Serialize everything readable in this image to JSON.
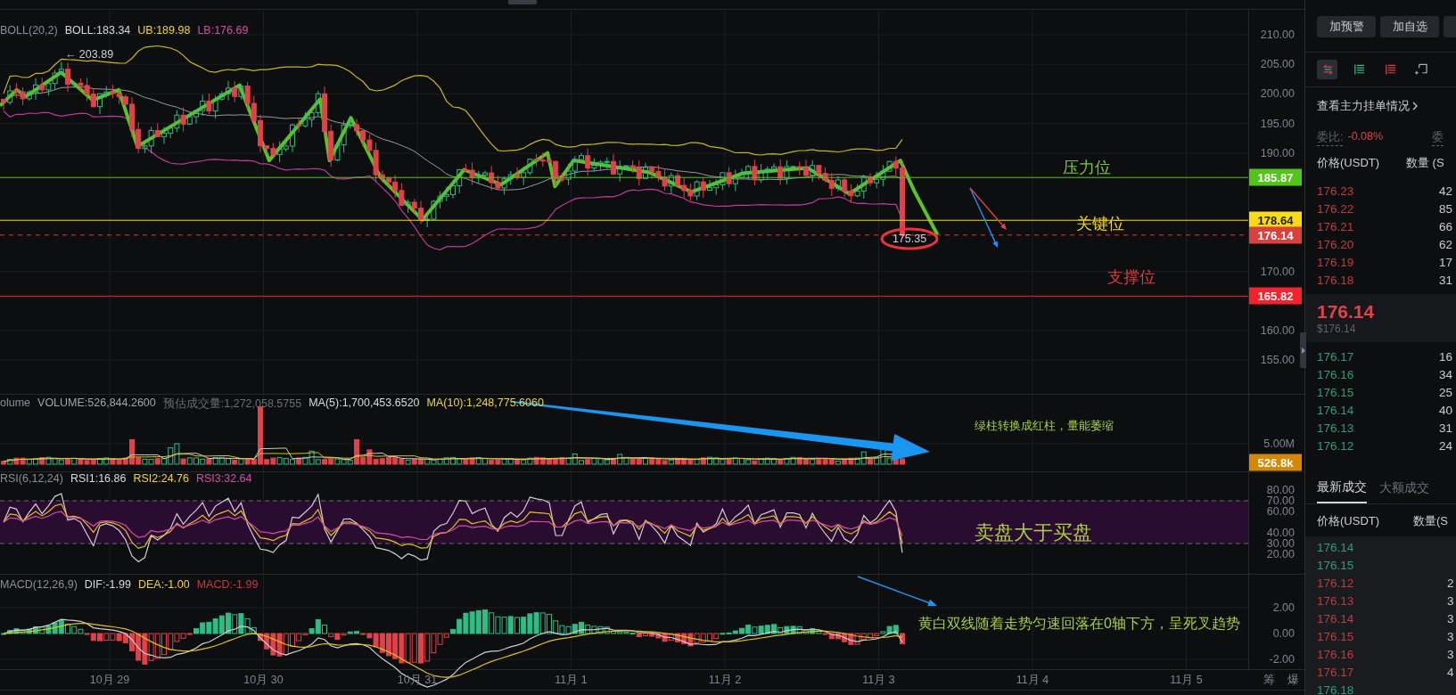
{
  "chart": {
    "main": {
      "legend": {
        "name": "BOLL(20,2)",
        "values": [
          {
            "text": "BOLL:183.34",
            "color": "#d9d9d9"
          },
          {
            "text": "UB:189.98",
            "color": "#f0d43a"
          },
          {
            "text": "LB:176.69",
            "color": "#d44fa8"
          }
        ]
      },
      "high_marker": "← 203.89",
      "low_marker": "175.35",
      "ticks": [
        "210.00",
        "205.00",
        "200.00",
        "195.00",
        "190.00",
        "170.00",
        "160.00",
        "155.00"
      ],
      "price_tags": [
        {
          "text": "185.87",
          "kind": "level",
          "color": "#52c41a"
        },
        {
          "text": "178.64",
          "kind": "level",
          "color": "#fadb14"
        },
        {
          "text": "176.14",
          "kind": "current",
          "color": "#d9413e"
        },
        {
          "text": "165.82",
          "kind": "level",
          "color": "#f5222d"
        }
      ],
      "annotations": [
        {
          "text": "压力位",
          "color": "#7cc83a"
        },
        {
          "text": "关键位",
          "color": "#f2d31b"
        },
        {
          "text": "支撑位",
          "color": "#e8393b"
        }
      ]
    },
    "volume": {
      "legend": {
        "name": "olume",
        "values": [
          {
            "text": "VOLUME:526,844.2600",
            "color": "#a3a3a3"
          },
          {
            "text": "预估成交量:1,272,058.5755",
            "color": "#6e6e6e"
          },
          {
            "text": "MA(5):1,700,453.6520",
            "color": "#d9d9d9"
          },
          {
            "text": "MA(10):1,248,775.6060",
            "color": "#f0d43a"
          }
        ]
      },
      "ticks": [
        "5.00M"
      ],
      "tag": {
        "text": "526.8k",
        "color": "#d48806"
      },
      "annotation": {
        "text": "绿柱转换成红柱，量能萎缩",
        "color": "#a6d041"
      }
    },
    "rsi": {
      "legend": {
        "name": "RSI(6,12,24)",
        "values": [
          {
            "text": "RSI1:16.86",
            "color": "#d9d9d9"
          },
          {
            "text": "RSI2:24.76",
            "color": "#f0d43a"
          },
          {
            "text": "RSI3:32.64",
            "color": "#d44fa8"
          }
        ]
      },
      "ticks": [
        "80.00",
        "70.00",
        "60.00",
        "40.00",
        "30.00",
        "20.00"
      ],
      "annotation": {
        "text": "卖盘大于买盘",
        "color": "#a6d041"
      }
    },
    "macd": {
      "legend": {
        "name": "MACD(12,26,9)",
        "values": [
          {
            "text": "DIF:-1.99",
            "color": "#d9d9d9"
          },
          {
            "text": "DEA:-1.00",
            "color": "#f0d43a"
          },
          {
            "text": "MACD:-1.99",
            "color": "#c9393b"
          }
        ]
      },
      "ticks": [
        "2.00",
        "0.00",
        "-2.00"
      ],
      "annotation": {
        "text": "黄白双线随着走势匀速回落在0轴下方，呈死叉趋势",
        "color": "#a6d041"
      }
    },
    "x_labels": [
      "10月 29",
      "10月 30",
      "10月 31",
      "11月 1",
      "11月 2",
      "11月 3",
      "11月 4",
      "11月 5"
    ],
    "axis_extras": [
      "筹",
      "爆"
    ]
  },
  "panel": {
    "buttons": [
      "加预警",
      "加自选"
    ],
    "view_tabs": [
      {
        "selected": true
      },
      {
        "selected": false
      },
      {
        "selected": false
      },
      {
        "selected": false
      }
    ],
    "depth_link": "查看主力挂单情况",
    "ratio": {
      "label": "委比:",
      "value": "-0.08%",
      "next_label": "委"
    },
    "book_headers": [
      "价格(USDT)",
      "数量 (S"
    ],
    "asks": [
      {
        "price": "176.23",
        "qty": "42"
      },
      {
        "price": "176.22",
        "qty": "85"
      },
      {
        "price": "176.21",
        "qty": "66"
      },
      {
        "price": "176.20",
        "qty": "62"
      },
      {
        "price": "176.19",
        "qty": "17"
      },
      {
        "price": "176.18",
        "qty": "31"
      }
    ],
    "last": {
      "price": "176.14",
      "usd": "$176.14"
    },
    "bids": [
      {
        "price": "176.17",
        "qty": "16"
      },
      {
        "price": "176.16",
        "qty": "34"
      },
      {
        "price": "176.15",
        "qty": "25"
      },
      {
        "price": "176.14",
        "qty": "40"
      },
      {
        "price": "176.13",
        "qty": "31"
      },
      {
        "price": "176.12",
        "qty": "24"
      }
    ],
    "trade_tabs": [
      {
        "label": "最新成交",
        "selected": true
      },
      {
        "label": "大额成交",
        "selected": false
      }
    ],
    "trade_headers": [
      "价格(USDT)",
      "数量(S"
    ],
    "trades": [
      {
        "price": "176.14",
        "color": "#26a17b"
      },
      {
        "price": "176.15",
        "color": "#26a17b"
      },
      {
        "price": "176.12",
        "qty": "2",
        "color": "#c23b3f"
      },
      {
        "price": "176.13",
        "qty": "3",
        "color": "#c23b3f"
      },
      {
        "price": "176.14",
        "qty": "3",
        "color": "#c23b3f"
      },
      {
        "price": "176.15",
        "qty": "3",
        "color": "#c23b3f"
      },
      {
        "price": "176.16",
        "qty": "3",
        "color": "#c23b3f"
      },
      {
        "price": "176.17",
        "qty": "4",
        "color": "#c23b3f"
      },
      {
        "price": "176.18",
        "color": "#26a17b"
      }
    ]
  }
}
